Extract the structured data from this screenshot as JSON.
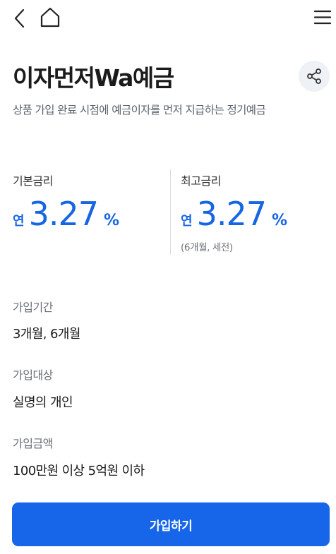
{
  "header": {
    "back_icon": "chevron-left-icon",
    "home_icon": "home-icon",
    "menu_icon": "hamburger-menu-icon"
  },
  "product": {
    "title": "이자먼저Wa예금",
    "subtitle": "상품 가입 완료 시점에 예금이자를 먼저 지급하는 정기예금",
    "share_icon": "share-icon"
  },
  "rates": {
    "base": {
      "label": "기본금리",
      "prefix": "연",
      "value": "3.27",
      "unit": "%"
    },
    "max": {
      "label": "최고금리",
      "prefix": "연",
      "value": "3.27",
      "unit": "%",
      "note": "(6개월, 세전)"
    }
  },
  "details": [
    {
      "label": "가입기간",
      "value": "3개월, 6개월"
    },
    {
      "label": "가입대상",
      "value": "실명의 개인"
    },
    {
      "label": "가입금액",
      "value": "100만원 이상 5억원 이하"
    }
  ],
  "cta": {
    "label": "가입하기"
  },
  "colors": {
    "accent": "#1766EA",
    "rate_text": "#1666E3",
    "share_bg": "#EEF1F5",
    "divider": "#D9DDE3"
  }
}
